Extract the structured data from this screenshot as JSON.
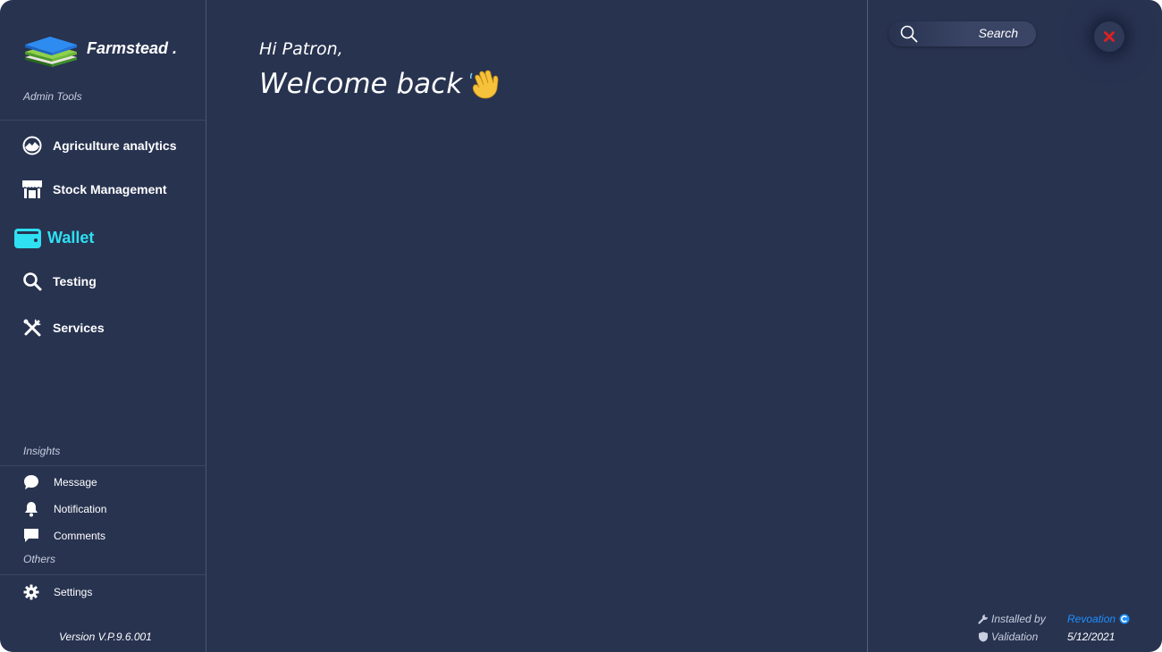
{
  "app": {
    "brand": "Farmstead .",
    "sections": {
      "admin_tools": "Admin Tools",
      "insights": "Insights",
      "others": "Others"
    },
    "version": "Version V.P.9.6.001"
  },
  "sidebar": {
    "items": [
      {
        "label": "Agriculture analytics",
        "icon": "analytics-icon"
      },
      {
        "label": "Stock Management",
        "icon": "store-icon"
      },
      {
        "label": "Wallet",
        "icon": "wallet-icon",
        "active": true
      },
      {
        "label": "Testing",
        "icon": "search-icon"
      },
      {
        "label": "Services",
        "icon": "tools-icon"
      }
    ],
    "insights": [
      {
        "label": "Message",
        "icon": "message-icon"
      },
      {
        "label": "Notification",
        "icon": "bell-icon"
      },
      {
        "label": "Comments",
        "icon": "comment-icon"
      }
    ],
    "others": [
      {
        "label": "Settings",
        "icon": "gear-icon"
      }
    ]
  },
  "main": {
    "greeting": "Hi Patron,",
    "welcome": "Welcome back",
    "wave_icon": "waving-hand-icon"
  },
  "right_panel": {
    "search": {
      "placeholder": "Search"
    },
    "close_icon": "close-icon",
    "installed_by_label": "Installed by",
    "installed_by_value": "Revoation",
    "validation_label": "Validation",
    "validation_value": "5/12/2021"
  },
  "colors": {
    "background": "#283350",
    "active": "#2ee0f2",
    "link": "#1e90ff",
    "close": "#e02020"
  }
}
